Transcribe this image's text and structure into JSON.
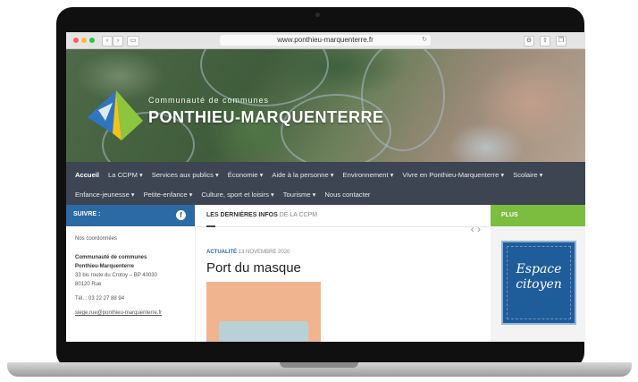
{
  "browser": {
    "url": "www.ponthieu-marquenterre.fr",
    "back_icon": "‹",
    "forward_icon": "›"
  },
  "header": {
    "org_small": "Communauté de communes",
    "org_big": "PONTHIEU-MARQUENTERRE"
  },
  "menu": {
    "row1": [
      "Accueil",
      "La CCPM",
      "Services aux publics",
      "Économie",
      "Aide à la personne",
      "Environnement",
      "Vivre en Ponthieu-Marquenterre",
      "Scolaire"
    ],
    "row2": [
      "Enfance-jeunesse",
      "Petite-enfance",
      "Culture, sport et loisirs",
      "Tourisme",
      "Nous contacter"
    ],
    "caret": "▾"
  },
  "sidebar_left": {
    "suivre": "SUIVRE :",
    "fb_icon_glyph": "f",
    "coords_title": "Nos coordonnées",
    "org_line1": "Communauté de communes",
    "org_line2": "Ponthieu-Marquenterre",
    "address1": "33 bis route du Crotoy – BP 40030",
    "address2": "80120 Rue",
    "tel": "Tél. : 03 22 27 88 94",
    "email": "siege.rue@ponthieu-marquenterre.fr"
  },
  "news": {
    "heading_bold": "LES DERNIÈRES INFOS",
    "heading_sub": "DE LA CCPM",
    "arrows": "‹  ›",
    "category": "ACTUALITÉ",
    "date": "13 NOVEMBRE 2020",
    "title": "Port du masque"
  },
  "sidebar_right": {
    "plus": "PLUS",
    "espace_line1": "Espace",
    "espace_line2": "citoyen"
  },
  "colors": {
    "menu_bg": "#3d4452",
    "suivre_bg": "#2c6aa5",
    "plus_bg": "#7cbc3f"
  }
}
